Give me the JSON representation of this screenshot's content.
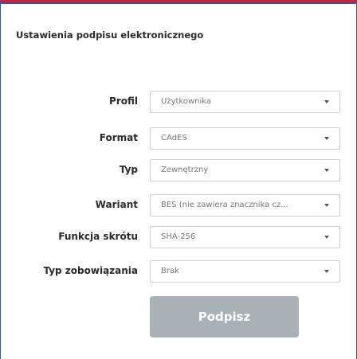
{
  "panel": {
    "title": "Ustawienia podpisu elektronicznego"
  },
  "fields": [
    {
      "label": "Profil",
      "value": "Użytkownika"
    },
    {
      "label": "Format",
      "value": "CAdES"
    },
    {
      "label": "Typ",
      "value": "Zewnętrzny"
    },
    {
      "label": "Wariant",
      "value": "BES (nie zawiera znacznika cz..."
    },
    {
      "label": "Funkcja skrótu",
      "value": "SHA-256"
    },
    {
      "label": "Typ zobowiązania",
      "value": "Brak"
    }
  ],
  "actions": {
    "sign_label": "Podpisz"
  },
  "colors": {
    "top_border": "#c8233b",
    "side_border": "#2c5aa0",
    "button_bg": "#a9b0b6"
  }
}
